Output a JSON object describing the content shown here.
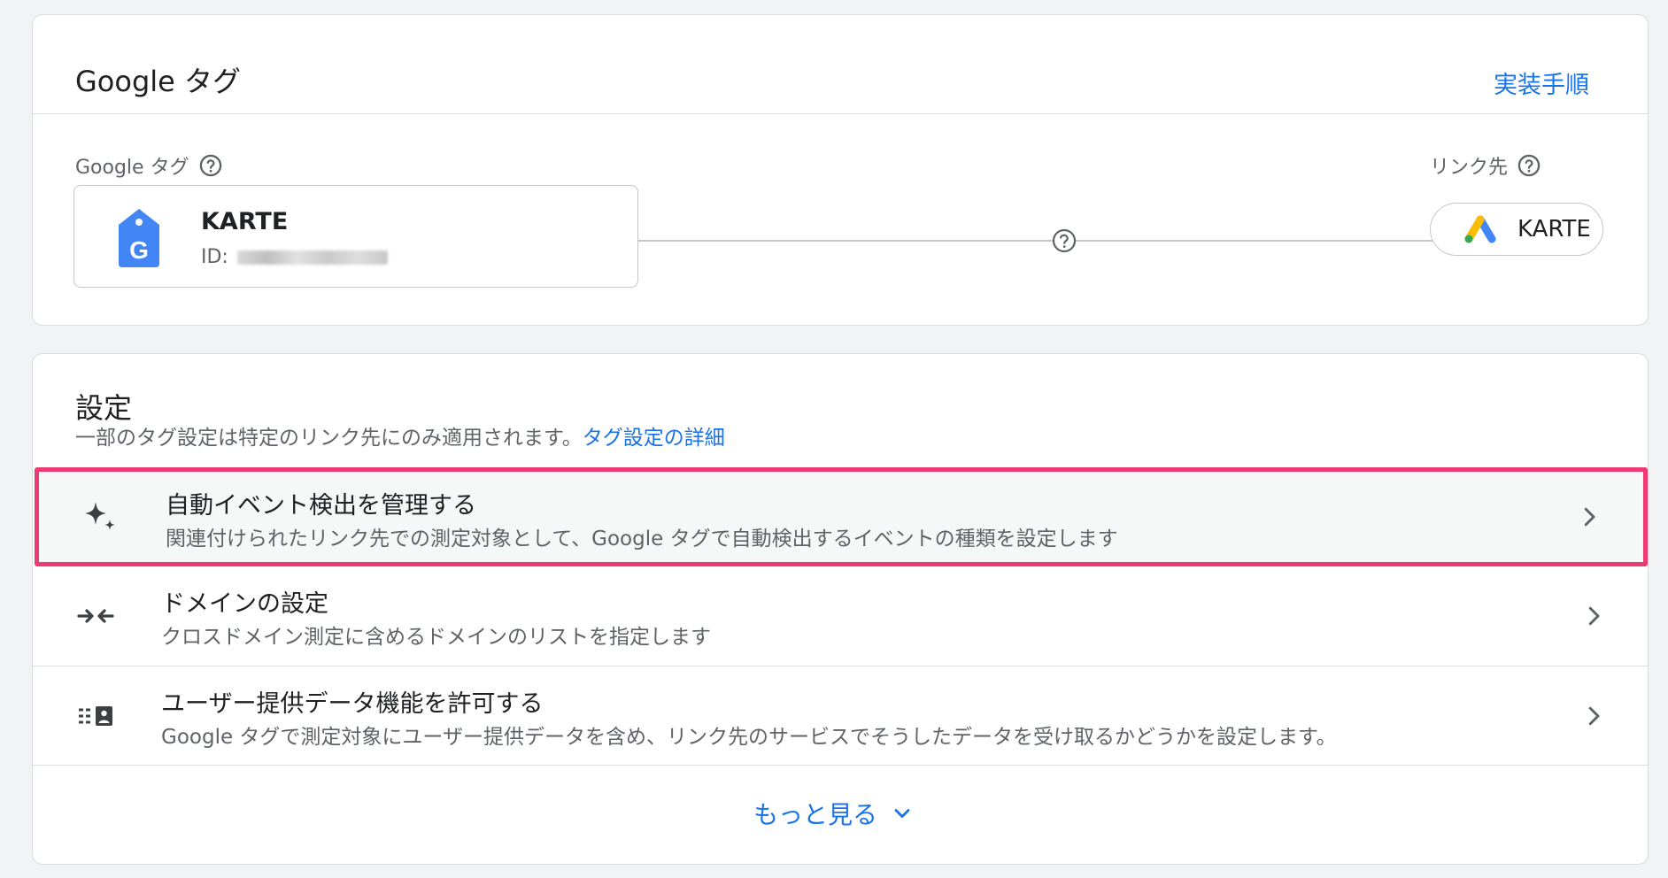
{
  "tag_card": {
    "title": "Google タグ",
    "implementation_link": "実装手順",
    "tag_label": "Google タグ",
    "tag_name": "KARTE",
    "tag_id_prefix": "ID:",
    "destination_label": "リンク先",
    "destination_name": "KARTE"
  },
  "settings_card": {
    "title": "設定",
    "description": "一部のタグ設定は特定のリンク先にのみ適用されます。",
    "description_link": "タグ設定の詳細",
    "rows": [
      {
        "icon": "sparkle-icon",
        "title": "自動イベント検出を管理する",
        "description": "関連付けられたリンク先での測定対象として、Google タグで自動検出するイベントの種類を設定します"
      },
      {
        "icon": "arrows-inward-icon",
        "title": "ドメインの設定",
        "description": "クロスドメイン測定に含めるドメインのリストを指定します"
      },
      {
        "icon": "user-data-icon",
        "title": "ユーザー提供データ機能を許可する",
        "description": "Google タグで測定対象にユーザー提供データを含め、リンク先のサービスでそうしたデータを受け取るかどうかを設定します。"
      }
    ],
    "more_label": "もっと見る"
  },
  "colors": {
    "accent": "#1a73e8",
    "highlight_border": "#ee3a74",
    "tag_blue": "#4285f4"
  }
}
